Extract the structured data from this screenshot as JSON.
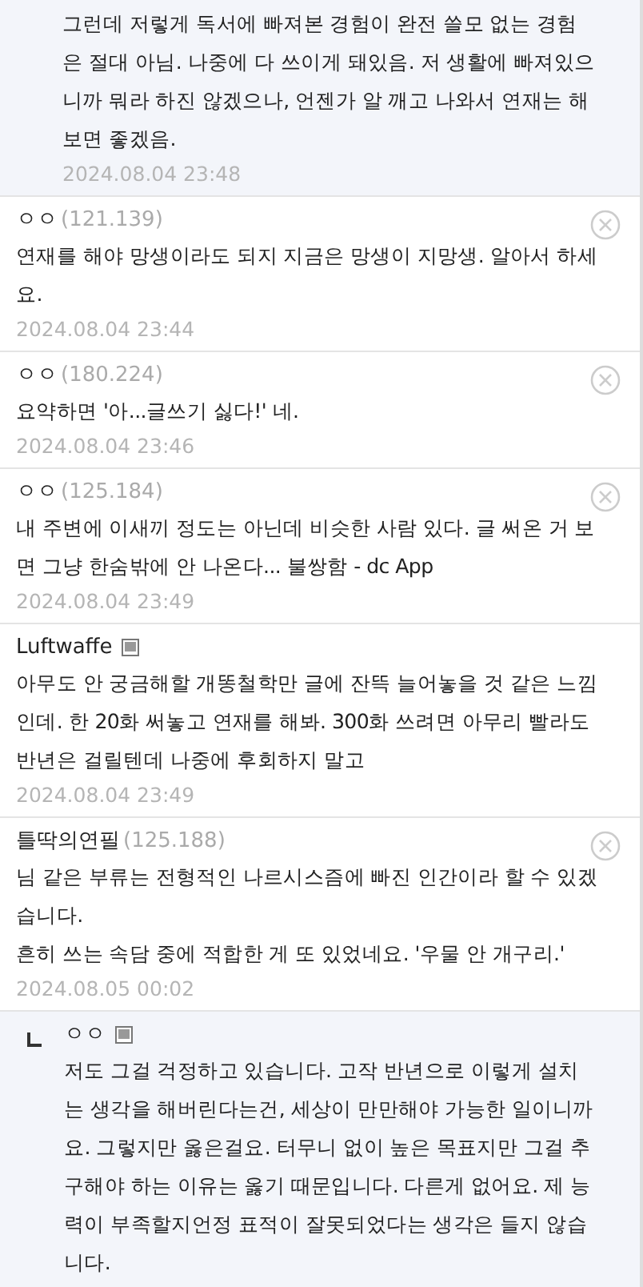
{
  "comments": [
    {
      "kind": "reply",
      "text": [
        "그런데 저렇게 독서에 빠져본 경험이 완전 쓸모 없는 경험은 절대 아님. 나중에 다 쓰이게 돼있음. 저 생활에 빠져있으니까 뭐라 하진 않겠으나, 언젠가 알 깨고 나와서 연재는 해보면 좋겠음."
      ],
      "date": "2024.08.04 23:48",
      "mobile": false,
      "deletable": false
    },
    {
      "kind": "comment",
      "author": "ㅇㅇ",
      "ip": "(121.139)",
      "text": [
        "연재를 해야 망생이라도 되지 지금은 망생이 지망생. 알아서 하세요."
      ],
      "date": "2024.08.04 23:44",
      "mobile": false,
      "deletable": true
    },
    {
      "kind": "comment",
      "author": "ㅇㅇ",
      "ip": "(180.224)",
      "text": [
        "요약하면 '아...글쓰기 싫다!' 네."
      ],
      "date": "2024.08.04 23:46",
      "mobile": false,
      "deletable": true
    },
    {
      "kind": "comment",
      "author": "ㅇㅇ",
      "ip": "(125.184)",
      "text": [
        "내 주변에 이새끼 정도는 아닌데 비슷한 사람 있다. 글 써온 거 보면 그냥 한숨밖에 안 나온다... 불쌍함 - dc App"
      ],
      "date": "2024.08.04 23:49",
      "mobile": false,
      "deletable": true
    },
    {
      "kind": "comment",
      "author": "Luftwaffe",
      "text": [
        "아무도 안 궁금해할 개똥철학만 글에 잔뜩 늘어놓을 것 같은 느낌인데. 한 20화 써놓고 연재를 해봐. 300화 쓰려면 아무리 빨라도 반년은 걸릴텐데 나중에 후회하지 말고"
      ],
      "date": "2024.08.04 23:49",
      "mobile": true,
      "deletable": false
    },
    {
      "kind": "comment",
      "author": "틀딱의연필",
      "ip": "(125.188)",
      "text": [
        "님 같은 부류는 전형적인 나르시스즘에 빠진 인간이라 할 수 있겠습니다.",
        "흔히 쓰는 속담 중에 적합한 게 또 있었네요. '우물 안 개구리.'"
      ],
      "date": "2024.08.05 00:02",
      "mobile": false,
      "deletable": true
    },
    {
      "kind": "reply",
      "author": "ㅇㅇ",
      "text": [
        "저도 그걸 걱정하고 있습니다. 고작 반년으로 이렇게 설치는 생각을 해버린다는건, 세상이 만만해야 가능한 일이니까요. 그렇지만 옳은걸요. 터무니 없이 높은 목표지만 그걸 추구해야 하는 이유는 옳기 때문입니다. 다른게 없어요. 제 능력이 부족할지언정 표적이 잘못되었다는 생각은 들지 않습니다."
      ],
      "mobile": true,
      "deletable": false
    }
  ]
}
